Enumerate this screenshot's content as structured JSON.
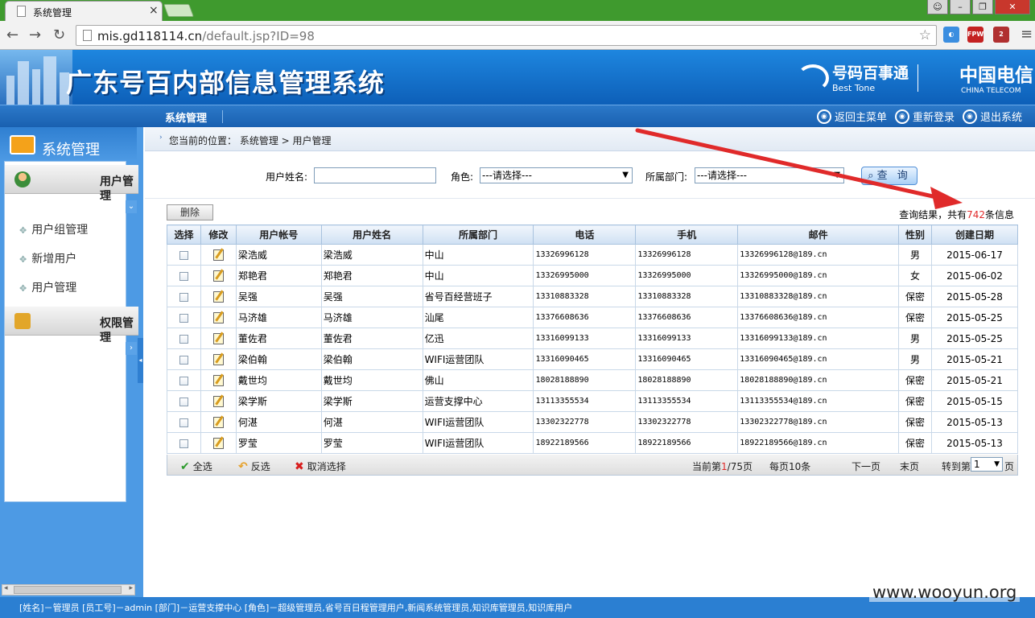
{
  "browser": {
    "tab_title": "系统管理",
    "url_host": "mis.gd118114.cn",
    "url_path": "/default.jsp?ID=98",
    "ext_labels": [
      "FPW",
      "2"
    ]
  },
  "header": {
    "app_title": "广东号百内部信息管理系统",
    "logo1_name": "号码百事通",
    "logo1_en": "Best Tone",
    "logo2_name": "中国电信",
    "logo2_en": "CHINA TELECOM"
  },
  "menubar": {
    "current": "系统管理",
    "actions": [
      "返回主菜单",
      "重新登录",
      "退出系统"
    ]
  },
  "sidebar": {
    "title": "系统管理",
    "groups": [
      {
        "label": "用户管理",
        "items": [
          "用户组管理",
          "新增用户",
          "用户管理"
        ]
      },
      {
        "label": "权限管理",
        "items": []
      }
    ]
  },
  "breadcrumb": {
    "text": "您当前的位置：  系统管理 > 用户管理"
  },
  "search": {
    "name_label": "用户姓名:",
    "name_value": "",
    "role_label": "角色:",
    "role_value": "---请选择---",
    "dept_label": "所属部门:",
    "dept_value": "---请选择---",
    "query_button": "查 询"
  },
  "toolbar": {
    "delete_label": "删除",
    "result_prefix": "查询结果，共有",
    "result_count": "742",
    "result_suffix": "条信息"
  },
  "table": {
    "headers": [
      "选择",
      "修改",
      "用户帐号",
      "用户姓名",
      "所属部门",
      "电话",
      "手机",
      "邮件",
      "性别",
      "创建日期"
    ],
    "rows": [
      [
        "梁浩威",
        "梁浩威",
        "中山",
        "13326996128",
        "13326996128",
        "13326996128@189.cn",
        "男",
        "2015-06-17"
      ],
      [
        "郑艳君",
        "郑艳君",
        "中山",
        "13326995000",
        "13326995000",
        "13326995000@189.cn",
        "女",
        "2015-06-02"
      ],
      [
        "吴强",
        "吴强",
        "省号百经营班子",
        "13310883328",
        "13310883328",
        "13310883328@189.cn",
        "保密",
        "2015-05-28"
      ],
      [
        "马济雄",
        "马济雄",
        "汕尾",
        "13376608636",
        "13376608636",
        "13376608636@189.cn",
        "保密",
        "2015-05-25"
      ],
      [
        "董佐君",
        "董佐君",
        "亿迅",
        "13316099133",
        "13316099133",
        "13316099133@189.cn",
        "男",
        "2015-05-25"
      ],
      [
        "梁伯翰",
        "梁伯翰",
        "WIFI运营团队",
        "13316090465",
        "13316090465",
        "13316090465@189.cn",
        "男",
        "2015-05-21"
      ],
      [
        "戴世均",
        "戴世均",
        "佛山",
        "18028188890",
        "18028188890",
        "18028188890@189.cn",
        "保密",
        "2015-05-21"
      ],
      [
        "梁学斯",
        "梁学斯",
        "运营支撑中心",
        "13113355534",
        "13113355534",
        "13113355534@189.cn",
        "保密",
        "2015-05-15"
      ],
      [
        "何湛",
        "何湛",
        "WIFI运营团队",
        "13302322778",
        "13302322778",
        "13302322778@189.cn",
        "保密",
        "2015-05-13"
      ],
      [
        "罗莹",
        "罗莹",
        "WIFI运营团队",
        "18922189566",
        "18922189566",
        "18922189566@189.cn",
        "保密",
        "2015-05-13"
      ]
    ]
  },
  "footer": {
    "select_all": "全选",
    "invert": "反选",
    "cancel": "取消选择",
    "page_prefix": "当前第",
    "page_current": "1",
    "page_total": "/75页",
    "per_page": "每页10条",
    "next": "下一页",
    "last": "末页",
    "goto_label": "转到第",
    "goto_value": "1",
    "goto_suffix": "页"
  },
  "status": {
    "text": "[姓名]－管理员 [员工号]－admin [部门]－运营支撑中心 [角色]－超级管理员,省号百日程管理用户,新闻系统管理员,知识库管理员,知识库用户"
  },
  "watermark": "www.wooyun.org",
  "colors": {
    "accent": "#1960b0",
    "result_count": "#e02a2a",
    "annotation_arrow": "#e02a2a"
  }
}
